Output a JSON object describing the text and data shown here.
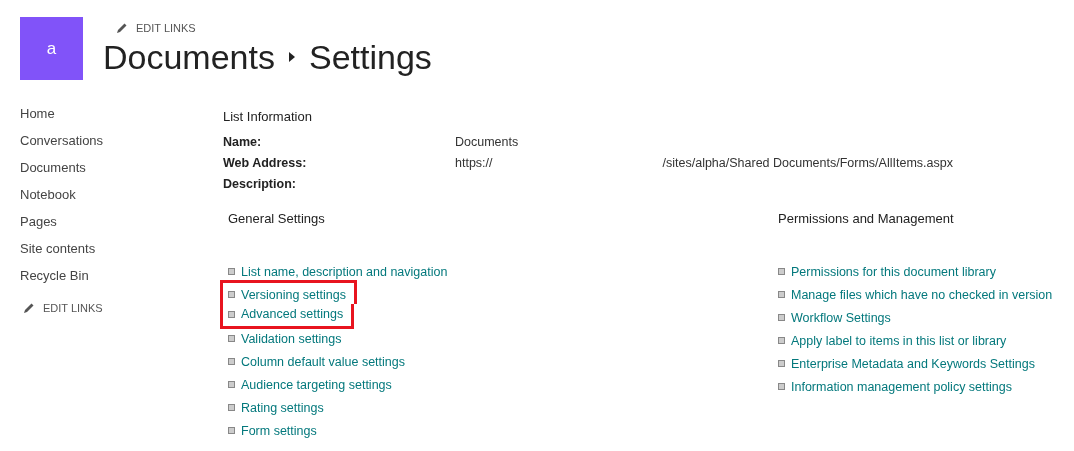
{
  "site_logo": {
    "letter": "a",
    "color": "#8153f9"
  },
  "top_edit_links": "EDIT LINKS",
  "breadcrumb": [
    "Documents",
    "Settings"
  ],
  "nav": {
    "items": [
      "Home",
      "Conversations",
      "Documents",
      "Notebook",
      "Pages",
      "Site contents",
      "Recycle Bin"
    ],
    "edit_links": "EDIT LINKS"
  },
  "list_information": {
    "heading": "List Information",
    "fields": [
      {
        "label": "Name:",
        "value": [
          "Documents"
        ]
      },
      {
        "label": "Web Address:",
        "value": [
          "https://",
          "/sites/alpha/Shared Documents/Forms/AllItems.aspx"
        ]
      },
      {
        "label": "Description:"
      }
    ]
  },
  "sections": [
    {
      "heading": "General Settings",
      "links": [
        {
          "text": "List name, description and navigation",
          "highlighted": false
        },
        {
          "text": "Versioning settings",
          "highlighted": true
        },
        {
          "text": "Advanced settings",
          "highlighted": true
        },
        {
          "text": "Validation settings",
          "highlighted": false
        },
        {
          "text": "Column default value settings",
          "highlighted": false
        },
        {
          "text": "Audience targeting settings",
          "highlighted": false
        },
        {
          "text": "Rating settings",
          "highlighted": false
        },
        {
          "text": "Form settings",
          "highlighted": false
        }
      ]
    },
    {
      "heading": "Permissions and Management",
      "links": [
        {
          "text": "Permissions for this document library",
          "highlighted": false
        },
        {
          "text": "Manage files which have no checked in version",
          "highlighted": false
        },
        {
          "text": "Workflow Settings",
          "highlighted": false
        },
        {
          "text": "Apply label to items in this list or library",
          "highlighted": false
        },
        {
          "text": "Enterprise Metadata and Keywords Settings",
          "highlighted": false
        },
        {
          "text": "Information management policy settings",
          "highlighted": false
        }
      ]
    }
  ]
}
